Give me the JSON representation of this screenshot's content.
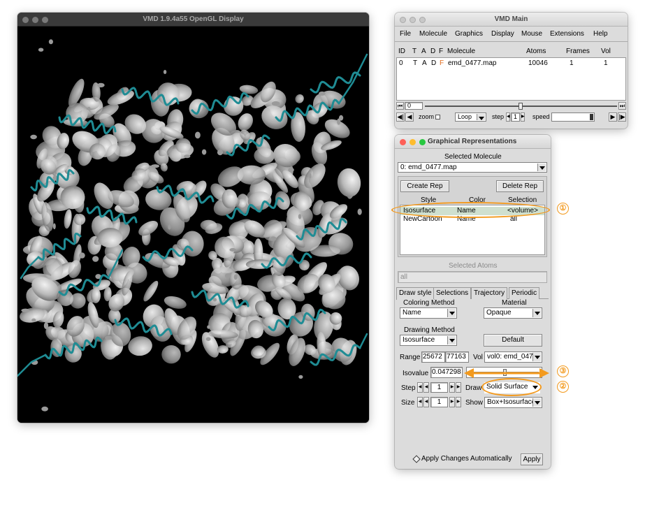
{
  "display_window": {
    "title": "VMD 1.9.4a55 OpenGL Display"
  },
  "main_window": {
    "title": "VMD Main",
    "menu": [
      "File",
      "Molecule",
      "Graphics",
      "Display",
      "Mouse",
      "Extensions",
      "Help"
    ],
    "columns": {
      "id": "ID",
      "t": "T",
      "a": "A",
      "d": "D",
      "f": "F",
      "molecule": "Molecule",
      "atoms": "Atoms",
      "frames": "Frames",
      "vol": "Vol"
    },
    "row": {
      "id": "0",
      "t": "T",
      "a": "A",
      "d": "D",
      "f": "F",
      "molecule": "emd_0477.map",
      "atoms": "10046",
      "frames": "1",
      "vol": "1"
    },
    "frame_value": "0",
    "zoom_label": "zoom",
    "loop_option": "Loop",
    "step_label": "step",
    "step_value": "1",
    "speed_label": "speed"
  },
  "reps_window": {
    "title": "Graphical Representations",
    "selected_molecule_label": "Selected Molecule",
    "selected_molecule": "0: emd_0477.map",
    "create_rep": "Create Rep",
    "delete_rep": "Delete Rep",
    "headers": {
      "style": "Style",
      "color": "Color",
      "selection": "Selection"
    },
    "reps": [
      {
        "style": "Isosurface",
        "color": "Name",
        "selection": "<volume>"
      },
      {
        "style": "NewCartoon",
        "color": "Name",
        "selection": "all"
      }
    ],
    "selected_atoms_label": "Selected Atoms",
    "selected_atoms_value": "all",
    "tabs": [
      "Draw style",
      "Selections",
      "Trajectory",
      "Periodic"
    ],
    "coloring_method_label": "Coloring Method",
    "coloring_method": "Name",
    "material_label": "Material",
    "material": "Opaque",
    "drawing_method_label": "Drawing Method",
    "drawing_method": "Isosurface",
    "default_button": "Default",
    "range_label": "Range",
    "range_min": "25672",
    "range_max": "77163",
    "vol_label": "Vol",
    "vol_value": "vol0: emd_047",
    "isovalue_label": "Isovalue",
    "isovalue": "0.047298",
    "step_label": "Step",
    "step_value": "1",
    "draw_label": "Draw",
    "draw_value": "Solid Surface",
    "size_label": "Size",
    "size_value": "1",
    "show_label": "Show",
    "show_value": "Box+Isosurface",
    "auto_apply_label": "Apply Changes Automatically",
    "apply_button": "Apply"
  },
  "annotations": {
    "one": "①",
    "two": "②",
    "three": "③",
    "color": "#f39a1e"
  }
}
